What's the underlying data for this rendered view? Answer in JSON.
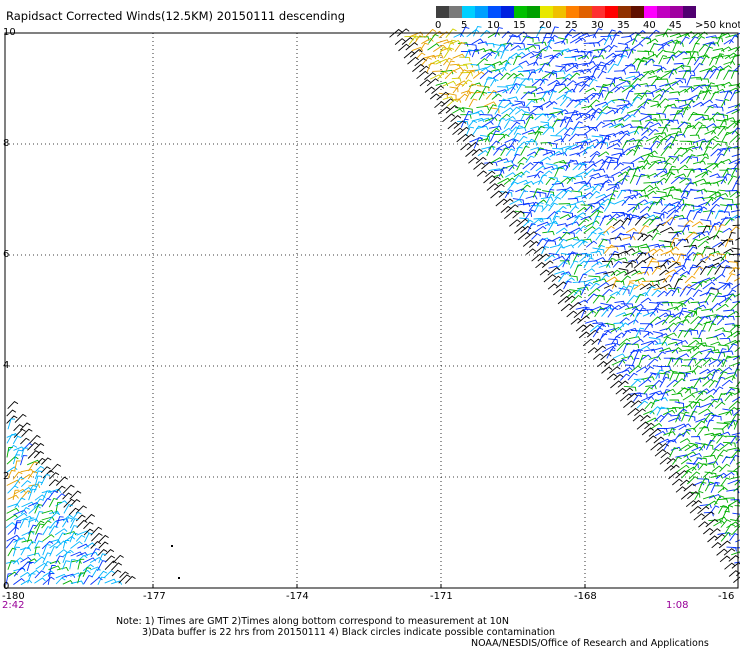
{
  "title": "Rapidsact Corrected Winds(12.5KM) 20150111 descending",
  "legend": {
    "colors": [
      "#404040",
      "#7a7a7a",
      "#00d0ff",
      "#00a0ff",
      "#0050ff",
      "#0020e0",
      "#00c000",
      "#00a000",
      "#e8e800",
      "#f0c000",
      "#ff8000",
      "#e06000",
      "#ff3030",
      "#ff0000",
      "#903000",
      "#601000",
      "#ff00ff",
      "#c000c0",
      "#a000a0",
      "#500070"
    ],
    "labels": [
      "0",
      "5",
      "10",
      "15",
      "20",
      "25",
      "30",
      "35",
      "40",
      "45",
      ">50 knots"
    ]
  },
  "lat_labels": [
    "10",
    "8",
    "6",
    "4",
    "2",
    "0"
  ],
  "lon_labels": [
    "-180",
    "-177",
    "-174",
    "-171",
    "-168",
    "-16"
  ],
  "time_labels": [
    "2:42",
    "1:08"
  ],
  "notes": [
    "Note: 1) Times are GMT 2)Times along bottom correspond to measurement at 10N",
    "3)Data buffer is 22 hrs from 20150111 4) Black circles indicate possible contamination",
    "NOAA/NESDIS/Office of Research and Applications"
  ]
}
